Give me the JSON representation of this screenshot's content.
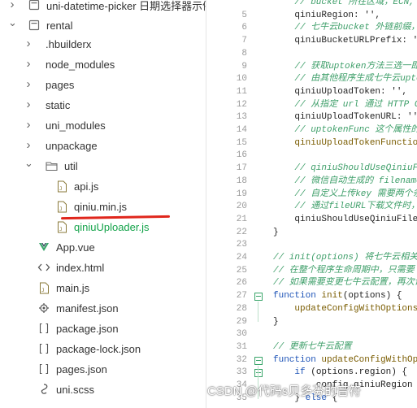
{
  "explorer": {
    "items": [
      {
        "label": "uni-datetime-picker 日期选择器示例",
        "indent": 0,
        "chevron": "right",
        "icon": "project-icon"
      },
      {
        "label": "rental",
        "indent": 0,
        "chevron": "down",
        "icon": "project-icon"
      },
      {
        "label": ".hbuilderx",
        "indent": 1,
        "chevron": "right",
        "icon": "folder-icon"
      },
      {
        "label": "node_modules",
        "indent": 1,
        "chevron": "right",
        "icon": "folder-icon"
      },
      {
        "label": "pages",
        "indent": 1,
        "chevron": "right",
        "icon": "folder-icon"
      },
      {
        "label": "static",
        "indent": 1,
        "chevron": "right",
        "icon": "folder-icon"
      },
      {
        "label": "uni_modules",
        "indent": 1,
        "chevron": "right",
        "icon": "folder-icon"
      },
      {
        "label": "unpackage",
        "indent": 1,
        "chevron": "right",
        "icon": "folder-icon"
      },
      {
        "label": "util",
        "indent": 1,
        "chevron": "down",
        "icon": "folder-open-icon"
      },
      {
        "label": "api.js",
        "indent": 2,
        "chevron": "",
        "icon": "js-file-icon"
      },
      {
        "label": "qiniu.min.js",
        "indent": 2,
        "chevron": "",
        "icon": "js-file-icon"
      },
      {
        "label": "qiniuUploader.js",
        "indent": 2,
        "chevron": "",
        "icon": "js-file-icon",
        "active": true
      },
      {
        "label": "App.vue",
        "indent": 1,
        "chevron": "",
        "icon": "vue-file-icon"
      },
      {
        "label": "index.html",
        "indent": 1,
        "chevron": "",
        "icon": "html-file-icon"
      },
      {
        "label": "main.js",
        "indent": 1,
        "chevron": "",
        "icon": "js-file-icon"
      },
      {
        "label": "manifest.json",
        "indent": 1,
        "chevron": "",
        "icon": "manifest-icon"
      },
      {
        "label": "package.json",
        "indent": 1,
        "chevron": "",
        "icon": "json-file-icon"
      },
      {
        "label": "package-lock.json",
        "indent": 1,
        "chevron": "",
        "icon": "json-file-icon"
      },
      {
        "label": "pages.json",
        "indent": 1,
        "chevron": "",
        "icon": "json-file-icon"
      },
      {
        "label": "uni.scss",
        "indent": 1,
        "chevron": "",
        "icon": "scss-file-icon"
      }
    ]
  },
  "editor": {
    "lines": [
      {
        "n": "",
        "tokens": [
          {
            "c": "cm",
            "t": "    // bucket 所在区域，ECN, SCN, NCN, NA, ASG，分别对应七牛的：华东，华南，华北，北美，新加坡 5 个区域"
          }
        ]
      },
      {
        "n": "5",
        "tokens": [
          {
            "c": "tx",
            "t": "    qiniuRegion: '',"
          }
        ]
      },
      {
        "n": "6",
        "tokens": [
          {
            "c": "cm",
            "t": "    // 七牛云bucket 外链前缀，外链在下载资源时用到"
          }
        ]
      },
      {
        "n": "7",
        "tokens": [
          {
            "c": "tx",
            "t": "    qiniuBucketURLPrefix: ''"
          }
        ]
      },
      {
        "n": "8",
        "tokens": []
      },
      {
        "n": "9",
        "tokens": [
          {
            "c": "cm",
            "t": "    // 获取uptoken方法三选一即可，执行优先级为：uptoken > uptokenURL > uptokenFunc"
          }
        ]
      },
      {
        "n": "10",
        "tokens": [
          {
            "c": "cm",
            "t": "    // 由其他程序生成七牛云uptoken，然后直接写入uptoken"
          }
        ]
      },
      {
        "n": "11",
        "tokens": [
          {
            "c": "tx",
            "t": "    qiniuUploadToken: '',"
          }
        ]
      },
      {
        "n": "12",
        "tokens": [
          {
            "c": "cm",
            "t": "    // 从指定 url 通过 HTTP GET 获取 uptoken"
          }
        ]
      },
      {
        "n": "13",
        "tokens": [
          {
            "c": "tx",
            "t": "    qiniuUploadTokenURL: '',"
          }
        ]
      },
      {
        "n": "14",
        "tokens": [
          {
            "c": "cm",
            "t": "    // uptokenFunc 这个属性的值可以是一个用来生成uptoken的函数"
          }
        ]
      },
      {
        "n": "15",
        "tokens": [
          {
            "c": "fn",
            "t": "    qiniuUploadTokenFunction: function () {"
          }
        ]
      },
      {
        "n": "16",
        "tokens": []
      },
      {
        "n": "17",
        "tokens": [
          {
            "c": "cm",
            "t": "    // qiniuShouldUseQiniuFileName 如果是 true，则文件的 key 由 qiniu 服务器分配"
          }
        ]
      },
      {
        "n": "18",
        "tokens": [
          {
            "c": "cm",
            "t": "    // 微信自动生成的 filename"
          }
        ]
      },
      {
        "n": "19",
        "tokens": [
          {
            "c": "cm",
            "t": "    // 自定义上传key 需要两个条件"
          }
        ]
      },
      {
        "n": "20",
        "tokens": [
          {
            "c": "cm",
            "t": "    // 通过fileURL下载文件时，需要"
          }
        ]
      },
      {
        "n": "21",
        "tokens": [
          {
            "c": "tx",
            "t": "    qiniuShouldUseQiniuFileName: false"
          }
        ]
      },
      {
        "n": "22",
        "tokens": [
          {
            "c": "tx",
            "t": "}"
          }
        ]
      },
      {
        "n": "23",
        "tokens": []
      },
      {
        "n": "24",
        "tokens": [
          {
            "c": "cm",
            "t": "// init(options) 将七牛云相关配置初始化进来"
          }
        ]
      },
      {
        "n": "25",
        "tokens": [
          {
            "c": "cm",
            "t": "// 在整个程序生命周期中，只需要 init 一次即可"
          }
        ]
      },
      {
        "n": "26",
        "tokens": [
          {
            "c": "cm",
            "t": "// 如果需要变更七牛云配置，再次调用 init 即可"
          }
        ]
      },
      {
        "n": "27",
        "tokens": [
          {
            "c": "kw",
            "t": "function "
          },
          {
            "c": "fn",
            "t": "init"
          },
          {
            "c": "tx",
            "t": "(options) {"
          }
        ]
      },
      {
        "n": "28",
        "tokens": [
          {
            "c": "fn",
            "t": "    updateConfigWithOptions(options);"
          }
        ]
      },
      {
        "n": "29",
        "tokens": [
          {
            "c": "tx",
            "t": "}"
          }
        ]
      },
      {
        "n": "30",
        "tokens": []
      },
      {
        "n": "31",
        "tokens": [
          {
            "c": "cm",
            "t": "// 更新七牛云配置"
          }
        ]
      },
      {
        "n": "32",
        "tokens": [
          {
            "c": "kw",
            "t": "function "
          },
          {
            "c": "fn",
            "t": "updateConfigWithOptions(options) {"
          }
        ]
      },
      {
        "n": "33",
        "tokens": [
          {
            "c": "kw",
            "t": "    if "
          },
          {
            "c": "tx",
            "t": "(options.region) {"
          }
        ]
      },
      {
        "n": "34",
        "tokens": [
          {
            "c": "tx",
            "t": "        config.qiniuRegion = options.region;"
          }
        ]
      },
      {
        "n": "35",
        "tokens": [
          {
            "c": "tx",
            "t": "    } "
          },
          {
            "c": "kw",
            "t": "else"
          },
          {
            "c": "tx",
            "t": " {"
          }
        ]
      }
    ]
  },
  "watermark": {
    "text": "CSDN @代码s贝多芬的音符"
  },
  "colors": {
    "comment": "#3f9f6a",
    "keyword": "#1f55b8",
    "active_file": "#14a34a",
    "annotation_underline": "#e0261c"
  }
}
